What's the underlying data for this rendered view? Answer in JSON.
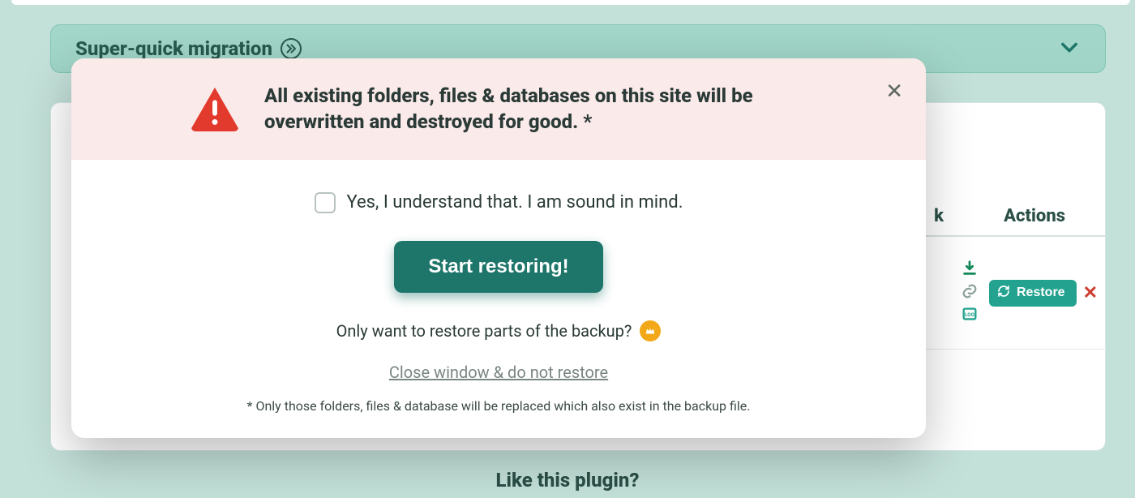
{
  "background": {
    "panel_title": "Super-quick migration",
    "table": {
      "col_k_fragment": "k",
      "col_actions": "Actions",
      "restore_button": "Restore"
    },
    "footer_like": "Like this plugin?"
  },
  "modal": {
    "warning_title": "All existing folders, files & databases on this site will be overwritten and destroyed for good. *",
    "consent_label": "Yes, I understand that. I am sound in mind.",
    "start_button": "Start restoring!",
    "partial_text": "Only want to restore parts of the backup?",
    "cancel_link": "Close window & do not restore",
    "footnote": "* Only those folders, files & database will be replaced which also exist in the backup file."
  },
  "colors": {
    "accent": "#1e766a",
    "danger": "#e23b2e",
    "pink": "#fbeaea"
  }
}
